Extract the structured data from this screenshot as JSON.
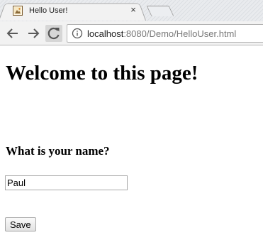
{
  "browser": {
    "tab": {
      "title": "Hello User!",
      "close_glyph": "×",
      "favicon": "webpage-favicon-icon"
    },
    "toolbar": {
      "back_icon": "arrow-left-icon",
      "forward_icon": "arrow-right-icon",
      "reload_icon": "reload-icon",
      "info_icon": "info-icon",
      "url_host": "localhost",
      "url_rest": ":8080/Demo/HelloUser.html"
    }
  },
  "page": {
    "heading": "Welcome to this page!",
    "question": "What is your name?",
    "name_input_value": "Paul",
    "save_label": "Save"
  }
}
